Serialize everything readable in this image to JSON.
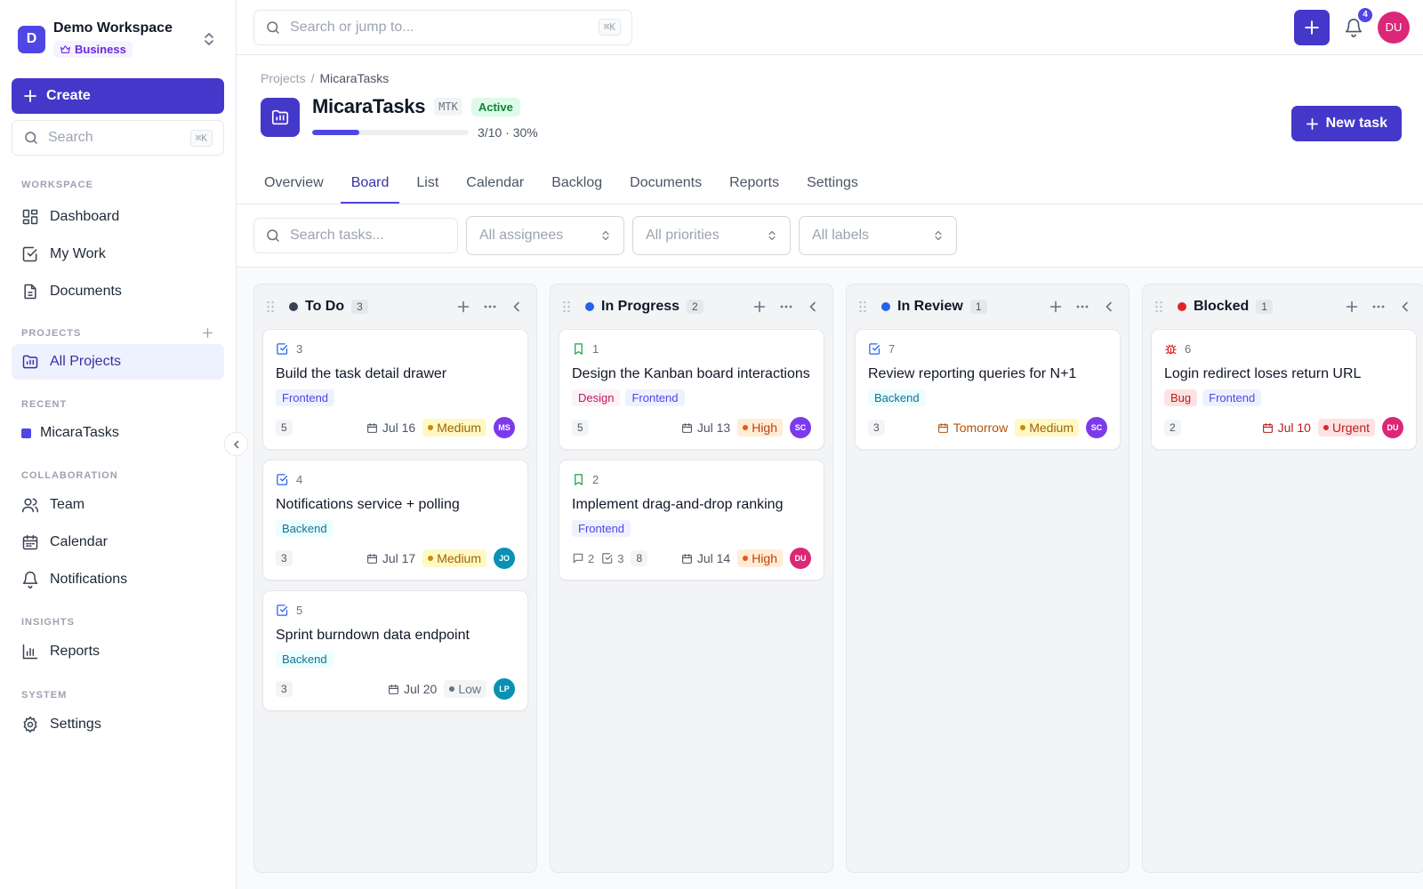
{
  "workspace": {
    "initial": "D",
    "name": "Demo Workspace",
    "plan": "Business"
  },
  "sidebar": {
    "create_label": "Create",
    "search_placeholder": "Search",
    "search_shortcut": "⌘K",
    "sections": {
      "workspace": "WORKSPACE",
      "projects": "PROJECTS",
      "recent": "RECENT",
      "collaboration": "COLLABORATION",
      "insights": "INSIGHTS",
      "system": "SYSTEM"
    },
    "items": {
      "dashboard": "Dashboard",
      "my_work": "My Work",
      "documents": "Documents",
      "all_projects": "All Projects",
      "recent_project": "MicaraTasks",
      "team": "Team",
      "calendar": "Calendar",
      "notifications": "Notifications",
      "reports": "Reports",
      "settings": "Settings"
    }
  },
  "topbar": {
    "search_placeholder": "Search or jump to...",
    "search_shortcut": "⌘K",
    "notification_count": "4",
    "user_initials": "DU"
  },
  "project": {
    "breadcrumb_root": "Projects",
    "breadcrumb_sep": "/",
    "breadcrumb_current": "MicaraTasks",
    "name": "MicaraTasks",
    "key": "MTK",
    "status": "Active",
    "progress_fraction": 0.3,
    "progress_text": "3/10 · 30%",
    "new_task_label": "New task"
  },
  "tabs": [
    "Overview",
    "Board",
    "List",
    "Calendar",
    "Backlog",
    "Documents",
    "Reports",
    "Settings"
  ],
  "filters": {
    "search_placeholder": "Search tasks...",
    "assignees": "All assignees",
    "priorities": "All priorities",
    "labels": "All labels"
  },
  "colors": {
    "accent": "#4338ca",
    "todo": "#374151",
    "in_progress": "#2563eb",
    "in_review": "#2563eb",
    "blocked": "#dc2626",
    "avatar_ms": "#7c3aed",
    "avatar_sc": "#7c3aed",
    "avatar_jo": "#0891b2",
    "avatar_lp": "#0891b2",
    "avatar_du": "#db2777"
  },
  "columns": [
    {
      "title": "To Do",
      "count": "3",
      "cards": [
        {
          "id": "3",
          "title": "Build the task detail drawer",
          "labels": [
            "Frontend"
          ],
          "points": "5",
          "due": "Jul 16",
          "priority": "Medium",
          "assignee": "MS"
        },
        {
          "id": "4",
          "title": "Notifications service + polling",
          "labels": [
            "Backend"
          ],
          "points": "3",
          "due": "Jul 17",
          "priority": "Medium",
          "assignee": "JO"
        },
        {
          "id": "5",
          "title": "Sprint burndown data endpoint",
          "labels": [
            "Backend"
          ],
          "points": "3",
          "due": "Jul 20",
          "priority": "Low",
          "assignee": "LP"
        }
      ]
    },
    {
      "title": "In Progress",
      "count": "2",
      "cards": [
        {
          "id": "1",
          "title": "Design the Kanban board interactions",
          "labels": [
            "Design",
            "Frontend"
          ],
          "points": "5",
          "due": "Jul 13",
          "priority": "High",
          "assignee": "SC"
        },
        {
          "id": "2",
          "title": "Implement drag-and-drop ranking",
          "labels": [
            "Frontend"
          ],
          "comments": "2",
          "subtasks": "3",
          "points": "8",
          "due": "Jul 14",
          "priority": "High",
          "assignee": "DU"
        }
      ]
    },
    {
      "title": "In Review",
      "count": "1",
      "cards": [
        {
          "id": "7",
          "title": "Review reporting queries for N+1",
          "labels": [
            "Backend"
          ],
          "points": "3",
          "due": "Tomorrow",
          "priority": "Medium",
          "assignee": "SC"
        }
      ]
    },
    {
      "title": "Blocked",
      "count": "1",
      "cards": [
        {
          "id": "6",
          "title": "Login redirect loses return URL",
          "labels": [
            "Bug",
            "Frontend"
          ],
          "points": "2",
          "due": "Jul 10",
          "priority": "Urgent",
          "assignee": "DU"
        }
      ]
    }
  ]
}
